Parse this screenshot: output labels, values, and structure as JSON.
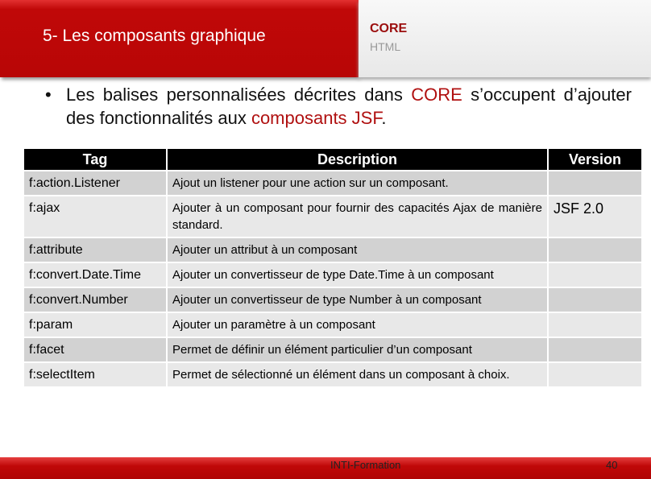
{
  "header": {
    "title": "5- Les composants graphique",
    "nav_active": "CORE",
    "nav_inactive": "HTML"
  },
  "bullet": {
    "p1": "Les balises personnalisées décrites dans ",
    "core": "CORE",
    "p2": " s’occupent d’ajouter des fonctionnalités aux ",
    "jsf": "composants JSF",
    "p3": "."
  },
  "table": {
    "headers": [
      "Tag",
      "Description",
      "Version"
    ],
    "rows": [
      {
        "tag": "f:action.Listener",
        "desc": "Ajout un listener pour une action sur un composant.",
        "version": ""
      },
      {
        "tag": "f:ajax",
        "desc": "Ajouter à un composant pour fournir des capacités Ajax de manière standard.",
        "version": "JSF 2.0"
      },
      {
        "tag": "f:attribute",
        "desc": "Ajouter un attribut à un composant",
        "version": ""
      },
      {
        "tag": "f:convert.Date.Time",
        "desc": "Ajouter un convertisseur de type Date.Time à un composant",
        "version": ""
      },
      {
        "tag": "f:convert.Number",
        "desc": "Ajouter un convertisseur de type Number à un composant",
        "version": ""
      },
      {
        "tag": "f:param",
        "desc": "Ajouter un paramètre à un composant",
        "version": ""
      },
      {
        "tag": "f:facet",
        "desc": "Permet de définir un élément particulier d’un composant",
        "version": ""
      },
      {
        "tag": "f:selectItem",
        "desc": "Permet de sélectionné un élément dans un composant à choix.",
        "version": ""
      }
    ]
  },
  "footer": {
    "label": "INTI-Formation",
    "page": "40"
  },
  "colors": {
    "brand_red": "#c00808",
    "header_black": "#000000"
  }
}
